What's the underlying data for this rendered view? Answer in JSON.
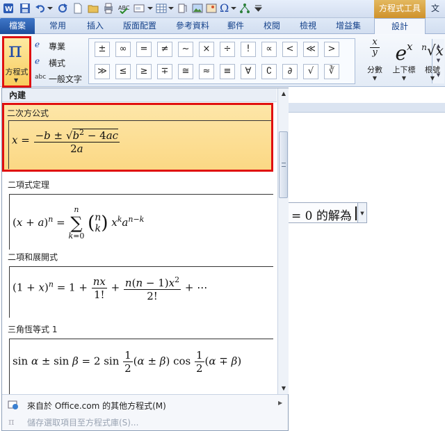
{
  "qat": {
    "icons": [
      "word-app-icon",
      "save-icon",
      "undo-icon",
      "redo-icon",
      "new-doc-icon",
      "open-icon",
      "print-preview-icon",
      "spelling-icon",
      "text-field-icon",
      "table-icon",
      "picture-icon",
      "image-icon",
      "clip-icon",
      "omega-icon",
      "diagram-icon",
      "qat-dropdown-icon"
    ]
  },
  "contextual_title": "方程式工具",
  "window_title_cut": "文",
  "tabs": [
    "檔案",
    "常用",
    "插入",
    "版面配置",
    "參考資料",
    "郵件",
    "校閱",
    "檢視",
    "增益集",
    "設計"
  ],
  "ribbon": {
    "equation_label": "方程式",
    "equation_symbol": "π",
    "options": [
      {
        "icon": "e",
        "label": "專業"
      },
      {
        "icon": "e",
        "label": "橫式"
      },
      {
        "icon": "abc",
        "label": "一般文字"
      }
    ],
    "symbols_row1": [
      "±",
      "∞",
      "=",
      "≠",
      "~",
      "×",
      "÷",
      "!",
      "∝",
      "<",
      "≪",
      ">"
    ],
    "symbols_row2": [
      "≫",
      "≤",
      "≥",
      "∓",
      "≅",
      "≈",
      "≡",
      "∀",
      "∁",
      "∂",
      "√",
      "∛"
    ],
    "structures": [
      {
        "glyph": "x/y",
        "label": "分數"
      },
      {
        "glyph": "eˣ",
        "label": "上下標"
      },
      {
        "glyph": "ⁿ√x",
        "label": "根號"
      }
    ]
  },
  "document": {
    "equation_text": "= 0 的解為"
  },
  "gallery": {
    "header": "內建",
    "entries": [
      {
        "title": "二次方公式"
      },
      {
        "title": "二項式定理"
      },
      {
        "title": "二項和展開式"
      },
      {
        "title": "三角恆等式 1"
      }
    ],
    "footer": [
      {
        "label": "來自於 Office.com 的其他方程式(M)"
      },
      {
        "label": "儲存選取項目至方程式庫(S)..."
      }
    ]
  },
  "colors": {
    "highlight": "#e01010",
    "selected_bg": "#fbd884",
    "contextual_tab": "#cf922b",
    "file_tab": "#2a5eaf"
  }
}
